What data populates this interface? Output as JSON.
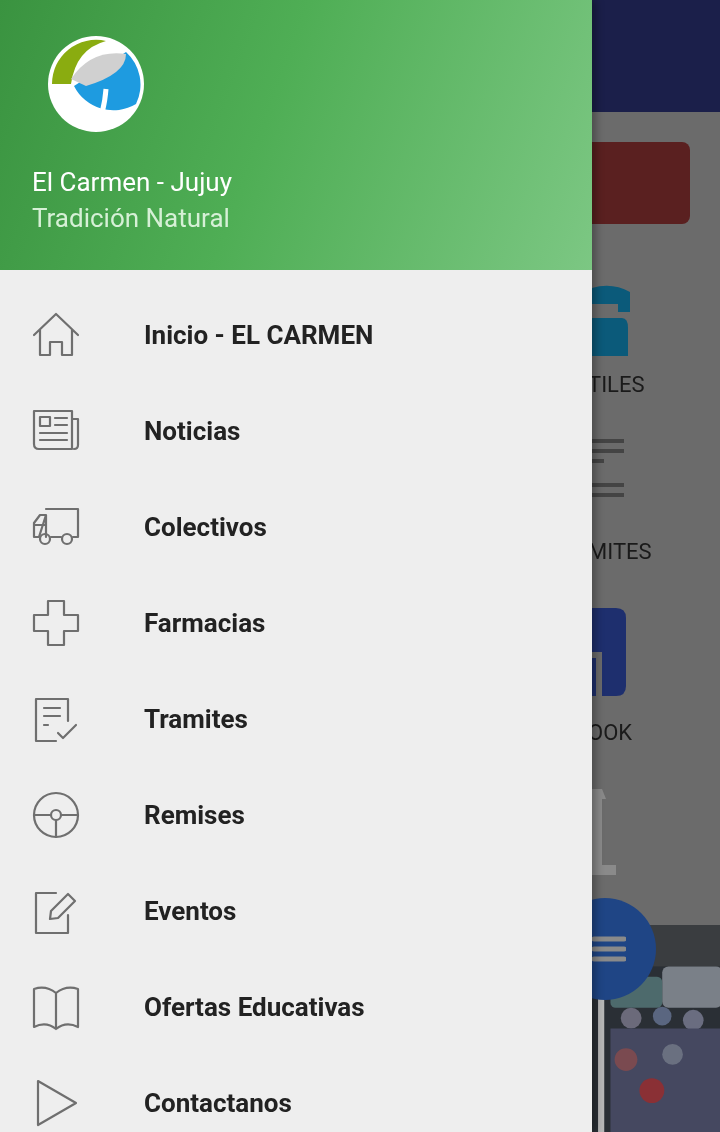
{
  "drawer": {
    "title": "El Carmen - Jujuy",
    "subtitle": "Tradición Natural",
    "items": [
      {
        "label": "Inicio - EL CARMEN"
      },
      {
        "label": "Noticias"
      },
      {
        "label": "Colectivos"
      },
      {
        "label": "Farmacias"
      },
      {
        "label": "Tramites"
      },
      {
        "label": "Remises"
      },
      {
        "label": "Eventos"
      },
      {
        "label": "Ofertas Educativas"
      },
      {
        "label": "Contactanos"
      }
    ]
  },
  "background": {
    "labels": [
      "TILES",
      "MITES",
      "OOK"
    ]
  }
}
